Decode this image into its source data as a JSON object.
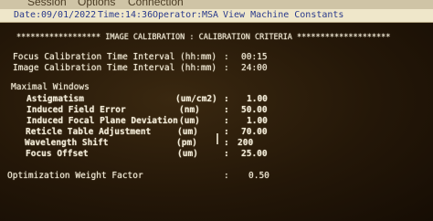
{
  "menu": {
    "items": [
      "Session",
      "Options",
      "Connection"
    ]
  },
  "infobar": {
    "date_label": "Date:",
    "date": "09/01/2022",
    "time_label": "Time:",
    "time": "14:36",
    "operator_label": "Operator:",
    "operator": "MSA",
    "view_label": "View Machine Constants"
  },
  "header": {
    "text": "****************** IMAGE CALIBRATION : CALIBRATION CRITERIA ********************"
  },
  "time_intervals": [
    {
      "label": "Focus Calibration Time Interval",
      "unit": "(hh:mm)",
      "sep": ":",
      "value": "00:15"
    },
    {
      "label": "Image Calibration Time Interval",
      "unit": "(hh:mm)",
      "sep": ":",
      "value": "24:00"
    }
  ],
  "maximal_windows": {
    "title": "Maximal Windows",
    "rows": [
      {
        "label": "Astigmatism",
        "unit": "(um/cm2)",
        "sep": ":",
        "value": "1.00"
      },
      {
        "label": "Induced Field Error",
        "unit": "(nm)",
        "sep": ":",
        "value": "50.00"
      },
      {
        "label": "Induced Focal Plane Deviation",
        "unit": "(um)",
        "sep": ":",
        "value": "1.00"
      },
      {
        "label": "Reticle Table Adjustment",
        "unit": "(um)",
        "sep": ":",
        "value": "70.00"
      },
      {
        "label": "Wavelength Shift",
        "unit": "(pm)",
        "sep": ":",
        "value": "200"
      },
      {
        "label": "Focus Offset",
        "unit": "(um)",
        "sep": ":",
        "value": "25.00"
      }
    ]
  },
  "optimization": {
    "label": "Optimization Weight Factor",
    "sep": ":",
    "value": "0.50"
  }
}
